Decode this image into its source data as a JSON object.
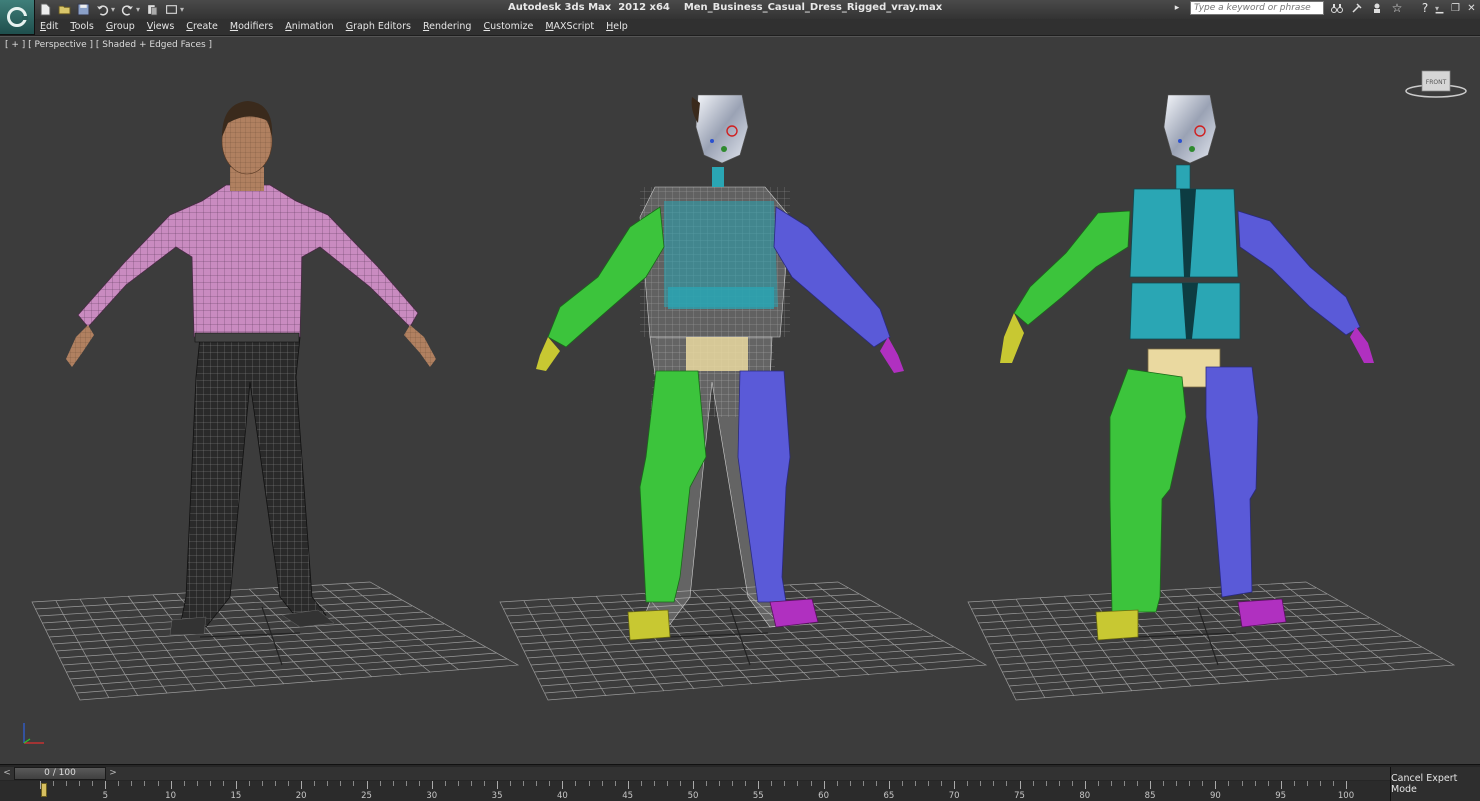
{
  "title": {
    "app": "Autodesk 3ds Max  2012 x64",
    "file": "Men_Business_Casual_Dress_Rigged_vray.max"
  },
  "quick_access_icons": [
    "new-file-icon",
    "open-file-icon",
    "save-icon",
    "undo-icon",
    "redo-icon",
    "hold-icon",
    "window-crossing-icon",
    "dropdown-icon"
  ],
  "infocenter": {
    "search_placeholder": "Type a keyword or phrase",
    "icons": [
      "binoculars-icon",
      "communication-center-icon",
      "favorites-star-icon",
      "help-icon"
    ]
  },
  "menus": [
    {
      "label": "Edit",
      "ul": "E",
      "rest": "dit"
    },
    {
      "label": "Tools",
      "ul": "T",
      "rest": "ools"
    },
    {
      "label": "Group",
      "ul": "G",
      "rest": "roup"
    },
    {
      "label": "Views",
      "ul": "V",
      "rest": "iews"
    },
    {
      "label": "Create",
      "ul": "C",
      "rest": "reate"
    },
    {
      "label": "Modifiers",
      "ul": "M",
      "rest": "odifiers"
    },
    {
      "label": "Animation",
      "ul": "A",
      "rest": "nimation"
    },
    {
      "label": "Graph Editors",
      "ul": "G",
      "rest": "raph Editors"
    },
    {
      "label": "Rendering",
      "ul": "R",
      "rest": "endering"
    },
    {
      "label": "Customize",
      "ul": "C",
      "rest": "ustomize"
    },
    {
      "label": "MAXScript",
      "ul": "M",
      "rest": "AXScript"
    },
    {
      "label": "Help",
      "ul": "H",
      "rest": "elp"
    }
  ],
  "viewport": {
    "label": "[ + ] [ Perspective ] [ Shaded + Edged Faces ]",
    "viewcube_label": "FRONT",
    "background": "#3c3c3c",
    "grid_color": "#9a9a9a"
  },
  "figures": {
    "shirt_color": "#c98bc0",
    "pants_color": "#2a2a2a",
    "skin_color": "#b08060",
    "rig_left_color": "#3cc43c",
    "rig_right_color": "#5a5ad8",
    "rig_torso_color": "#2aa6b4",
    "rig_pelvis_color": "#ead9a0",
    "rig_left_foot_color": "#c8c832",
    "rig_right_foot_color": "#b030c0",
    "head_color": "#c8ccd6"
  },
  "timeline": {
    "frame_display": "0 / 100",
    "prev": "<",
    "next": ">",
    "ticks": [
      "0",
      "5",
      "10",
      "15",
      "20",
      "25",
      "30",
      "35",
      "40",
      "45",
      "50",
      "55",
      "60",
      "65",
      "70",
      "75",
      "80",
      "85",
      "90",
      "95",
      "100"
    ]
  },
  "status": {
    "cancel_expert_mode": "Cancel Expert Mode"
  }
}
